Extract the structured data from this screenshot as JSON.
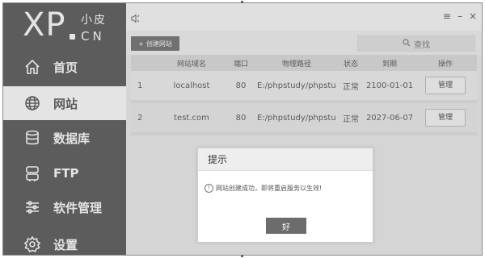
{
  "logo": {
    "main": "XP",
    "sub1": "小皮",
    "sub2": "CN"
  },
  "sidebar": {
    "items": [
      {
        "label": "首页",
        "icon": "home-icon",
        "active": false
      },
      {
        "label": "网站",
        "icon": "globe-icon",
        "active": true
      },
      {
        "label": "数据库",
        "icon": "database-icon",
        "active": false
      },
      {
        "label": "FTP",
        "icon": "server-icon",
        "active": false
      },
      {
        "label": "软件管理",
        "icon": "sliders-icon",
        "active": false
      },
      {
        "label": "设置",
        "icon": "gear-icon",
        "active": false
      }
    ]
  },
  "topbar": {
    "speaker_icon": "speaker-icon",
    "menu": "≡",
    "minimize": "–",
    "close": "×"
  },
  "toolbar": {
    "create_label": "创建网站",
    "create_plus": "+",
    "search_placeholder": "查找"
  },
  "table": {
    "headers": [
      "",
      "网站域名",
      "端口",
      "物理路径",
      "状态",
      "到期",
      "操作"
    ],
    "rows": [
      {
        "index": "1",
        "domain": "localhost",
        "port": "80",
        "path": "E:/phpstudy/phpstu...",
        "status": "正常",
        "expire": "2100-01-01",
        "action": "管理"
      },
      {
        "index": "2",
        "domain": "test.com",
        "port": "80",
        "path": "E:/phpstudy/phpstu...",
        "status": "正常",
        "expire": "2027-06-07",
        "action": "管理"
      }
    ]
  },
  "dialog": {
    "title": "提示",
    "message": "网站创建成功，即将重启服务以生效!",
    "ok_label": "好"
  },
  "colors": {
    "sidebar_bg": "#555555",
    "button_dark": "#6c6c6c",
    "main_bg": "#ededed"
  }
}
